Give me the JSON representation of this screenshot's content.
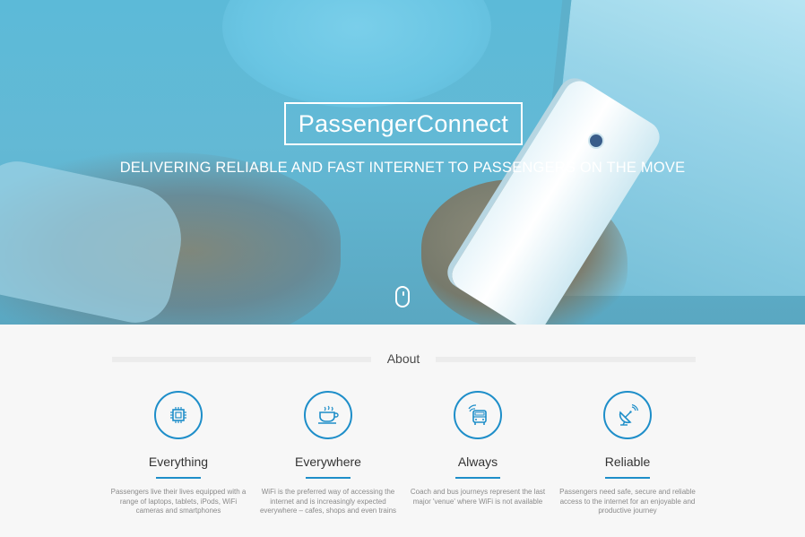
{
  "hero": {
    "brand": "PassengerConnect",
    "tagline": "DELIVERING RELIABLE AND FAST INTERNET TO PASSENGERS ON THE MOVE",
    "scroll_icon": "mouse-scroll-icon"
  },
  "about": {
    "title": "About",
    "features": [
      {
        "icon": "chip-icon",
        "title": "Everything",
        "text": "Passengers live their lives equipped with a range of laptops, tablets, iPods, WiFi cameras and smartphones"
      },
      {
        "icon": "coffee-cup-icon",
        "title": "Everywhere",
        "text": "WiFi is the preferred way of accessing the internet and is increasingly expected everywhere – cafes, shops and even trains"
      },
      {
        "icon": "bus-wifi-icon",
        "title": "Always",
        "text": "Coach and bus journeys represent the last major 'venue' where WiFi is not available"
      },
      {
        "icon": "satellite-dish-icon",
        "title": "Reliable",
        "text": "Passengers need safe, secure and reliable access to the internet for an enjoyable and productive journey"
      }
    ]
  },
  "colors": {
    "accent": "#1e8ec9",
    "hero_tint": "#5cbad8"
  }
}
